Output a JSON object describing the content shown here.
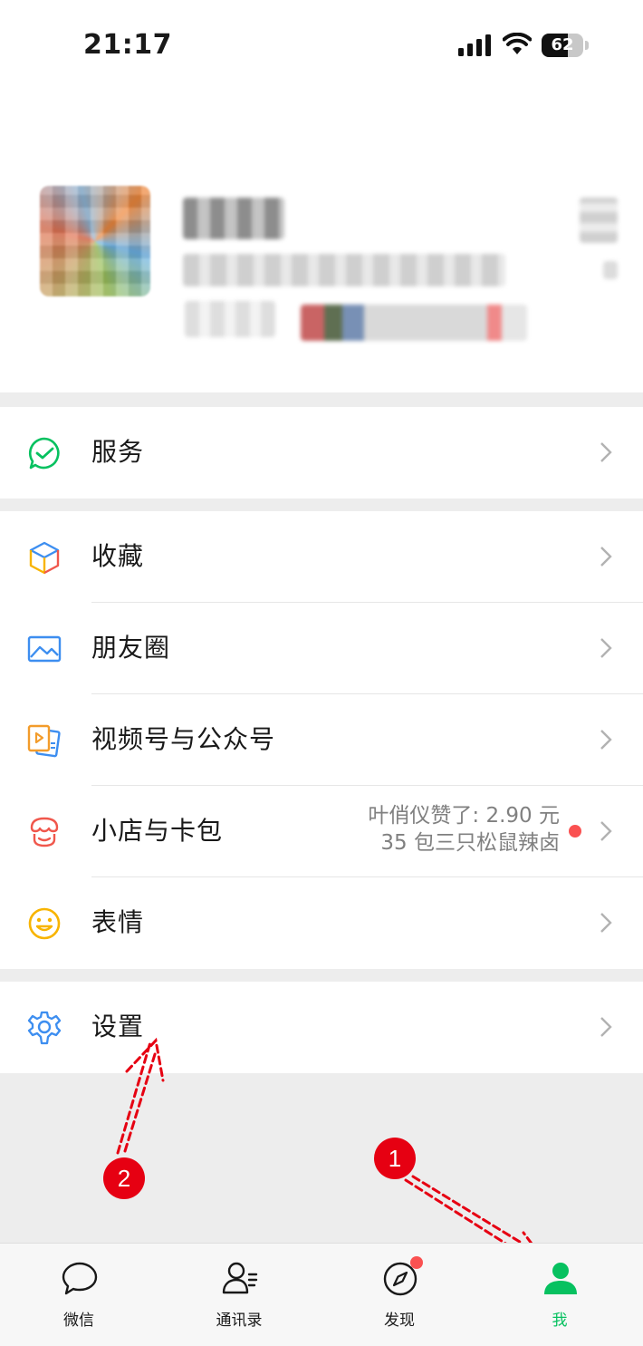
{
  "status_bar": {
    "time": "21:17",
    "battery": "62",
    "battery_level": 0.62
  },
  "profile": {
    "avatar": "avatar-image-blurred"
  },
  "menu": {
    "service": {
      "label": "服务",
      "icon": "service-icon"
    },
    "favorites": {
      "label": "收藏",
      "icon": "favorites-cube-icon"
    },
    "moments": {
      "label": "朋友圈",
      "icon": "moments-image-icon"
    },
    "channels": {
      "label": "视频号与公众号",
      "icon": "channels-icon"
    },
    "shop": {
      "label": "小店与卡包",
      "icon": "shop-icon",
      "note_line1": "叶俏仪赞了: 2.90 元",
      "note_line2": "35 包三只松鼠辣卤"
    },
    "stickers": {
      "label": "表情",
      "icon": "sticker-smile-icon"
    },
    "settings": {
      "label": "设置",
      "icon": "settings-gear-icon"
    }
  },
  "annotations": {
    "badge1": "1",
    "badge2": "2"
  },
  "tabbar": {
    "chats": "微信",
    "contacts": "通讯录",
    "discover": "发现",
    "me": "我"
  },
  "colors": {
    "accent": "#07c160",
    "badge": "#fa5151",
    "annotation": "#e60012"
  }
}
